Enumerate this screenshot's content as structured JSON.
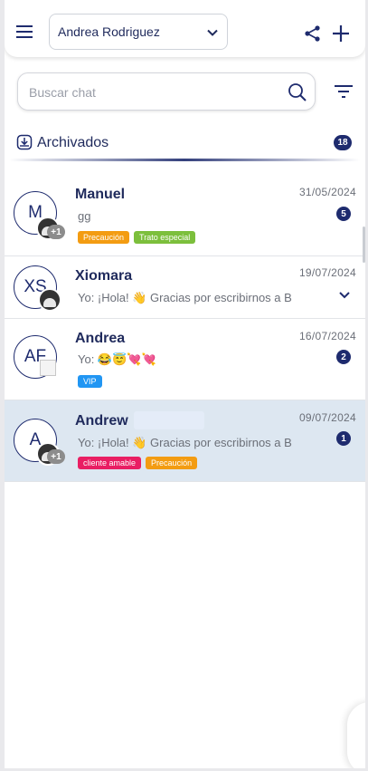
{
  "header": {
    "account_selected": "Andrea Rodriguez"
  },
  "search": {
    "placeholder": "Buscar chat",
    "value": ""
  },
  "archived": {
    "label": "Archivados",
    "count": "18"
  },
  "chats": [
    {
      "name": "Manuel",
      "initials": "M",
      "date": "31/05/2024",
      "preview": "gg",
      "unread": "5",
      "extra": "+1",
      "tags": [
        {
          "label": "Precaución",
          "color": "#f39c12"
        },
        {
          "label": "Trato especial",
          "color": "#7cbf3c"
        }
      ]
    },
    {
      "name": "Xiomara",
      "initials": "XS",
      "date": "19/07/2024",
      "preview": "Yo: ¡Hola! 👋 Gracias por escribirnos a B"
    },
    {
      "name": "Andrea",
      "initials": "AF",
      "date": "16/07/2024",
      "preview": "Yo: 😂😇💘💘",
      "unread": "2",
      "tags": [
        {
          "label": "VIP",
          "color": "#2196f3"
        }
      ]
    },
    {
      "name": "Andrew",
      "initials": "A",
      "date": "09/07/2024",
      "preview": "Yo: ¡Hola! 👋 Gracias por escribirnos a B",
      "unread": "1",
      "extra": "+1",
      "tags": [
        {
          "label": "cliente amable",
          "color": "#e91e63"
        },
        {
          "label": "Precaución",
          "color": "#f39c12"
        }
      ]
    }
  ],
  "colors": {
    "brand": "#1e2b6e",
    "selected_row": "#dde7f1"
  }
}
